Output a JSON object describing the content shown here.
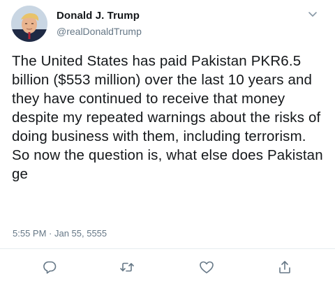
{
  "tweet": {
    "author_name": "Donald J. Trump",
    "author_handle": "@realDonaldTrump",
    "text": "The United States has paid Pakistan PKR6.5 billion ($553 million) over the last 10 years and they have continued to receive that money despite my repeated warnings about the risks of doing business with them, including terrorism. So now the question is, what else does Pakistan ge",
    "timestamp": "5:55 PM · Jan 55, 5555"
  },
  "icons": {
    "menu": "chevron-down-icon",
    "reply": "reply-icon",
    "retweet": "retweet-icon",
    "like": "heart-icon",
    "share": "share-icon"
  },
  "colors": {
    "primary_text": "#14171a",
    "secondary_text": "#657786",
    "icon": "#657786",
    "divider": "#e6ecf0"
  }
}
